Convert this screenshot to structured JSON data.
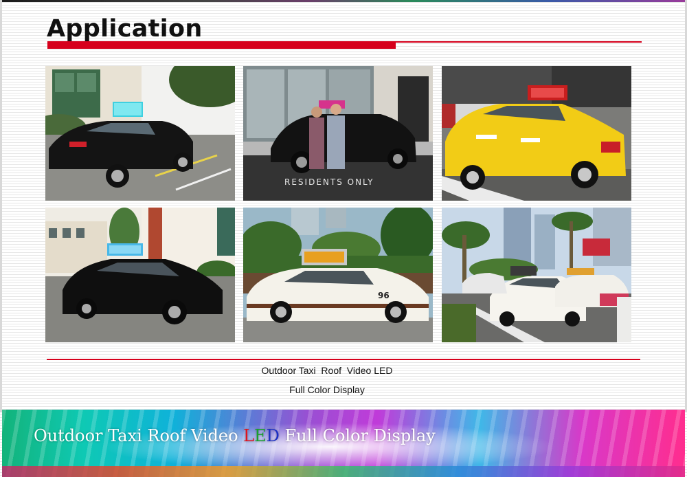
{
  "slide": {
    "title": "Application",
    "accent_color": "#d6001c"
  },
  "photos": [
    {
      "name": "black-sedan-with-roof-led-sign",
      "sign_color": "#3fd0e0"
    },
    {
      "name": "london-cab-with-two-people",
      "ground_text": "RESIDENTS ONLY"
    },
    {
      "name": "yellow-taxi-with-roof-led-sign",
      "sign_color": "#d02020"
    },
    {
      "name": "black-sedan-side-view-roof-sign",
      "sign_color": "#48b8e8"
    },
    {
      "name": "white-taxi-palm-trees",
      "car_number": "96"
    },
    {
      "name": "las-vegas-taxis-street"
    }
  ],
  "caption": {
    "line1": "Outdoor Taxi  Roof  Video LED",
    "line2": "Full Color Display"
  },
  "banner": {
    "text_before": "Outdoor Taxi Roof Video ",
    "led_L": "L",
    "led_E": "E",
    "led_D": "D",
    "text_after": " Full Color Display",
    "led_colors": {
      "L": "#e0141e",
      "E": "#18a02c",
      "D": "#1b2fc4"
    }
  }
}
